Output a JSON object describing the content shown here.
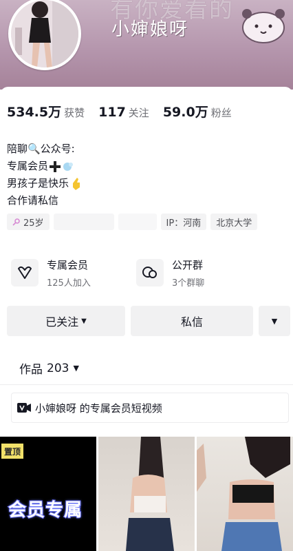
{
  "header": {
    "banner_text": "有你爱看的",
    "handle": "小婶娘呀"
  },
  "stats": [
    {
      "value": "534.5万",
      "label": "获赞"
    },
    {
      "value": "117",
      "label": "关注"
    },
    {
      "value": "59.0万",
      "label": "粉丝"
    }
  ],
  "bio": {
    "line1": "陪聊🔍公众号:",
    "line2": "专属会员",
    "line3": "男孩子是快乐",
    "line4": "合作请私信"
  },
  "tags": {
    "age": "25岁",
    "ip": "IP：河南",
    "school": "北京大学"
  },
  "features": [
    {
      "title": "专属会员",
      "sub": "125人加入",
      "icon": "heart-v-icon"
    },
    {
      "title": "公开群",
      "sub": "3个群聊",
      "icon": "group-chat-icon"
    }
  ],
  "actions": {
    "follow": "已关注",
    "message": "私信"
  },
  "works": {
    "label": "作品",
    "count": "203"
  },
  "vip_banner": {
    "text": "小婶娘呀 的专属会员短视频"
  },
  "videos": {
    "top_badge": "置顶",
    "cover_text": "会员专属"
  },
  "colors": {
    "banner": "#b596ad",
    "button_bg": "#f1f1f2",
    "badge": "#f2e16a"
  }
}
